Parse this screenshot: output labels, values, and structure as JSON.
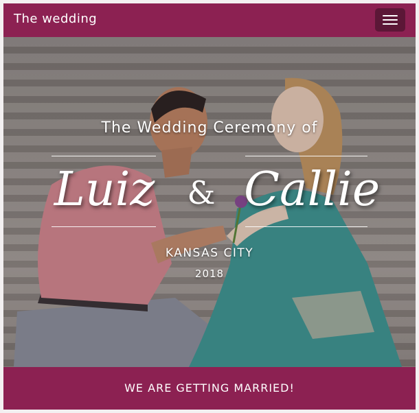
{
  "navbar": {
    "brand": "The wedding",
    "toggle_icon": "hamburger-menu-icon",
    "background": "#8c2152"
  },
  "hero": {
    "photo": "couple-on-stairs-photo",
    "heading": "The Wedding Ceremony of",
    "name_left": "Luiz",
    "ampersand": "&",
    "name_right": "Callie",
    "city": "KANSAS CITY",
    "year": "2018"
  },
  "footer": {
    "message": "WE ARE GETTING MARRIED!",
    "background": "#8c2152"
  }
}
